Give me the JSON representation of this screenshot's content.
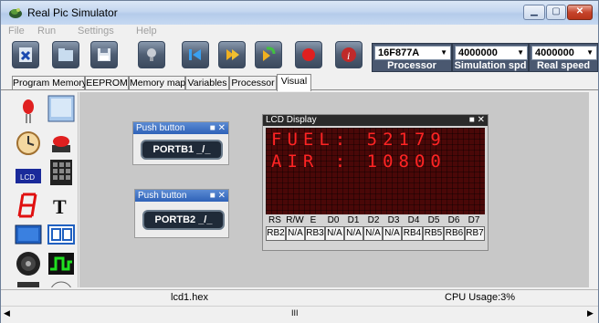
{
  "window": {
    "title": "Real Pic Simulator"
  },
  "menu": [
    {
      "label": "File",
      "mnemonic": "F"
    },
    {
      "label": "Run",
      "mnemonic": "R"
    },
    {
      "label": "Settings",
      "mnemonic": "S"
    },
    {
      "label": "Help",
      "mnemonic": "H"
    }
  ],
  "toolbar": {
    "icons": [
      "close-file-icon",
      "open-folder-icon",
      "save-icon",
      "lightbulb-icon",
      "step-back-icon",
      "run-icon",
      "step-into-icon",
      "stop-icon",
      "info-icon"
    ],
    "processor": {
      "value": "16F877A",
      "label": "Processor"
    },
    "sim_speed": {
      "value": "4000000",
      "label": "Simulation spd"
    },
    "real_speed": {
      "value": "4000000",
      "label": "Real speed"
    }
  },
  "tabs": [
    "Program Memory",
    "EEPROM",
    "Memory map",
    "Variables",
    "Processor",
    "Visual"
  ],
  "active_tab": "Visual",
  "palette": [
    "led-icon",
    "lcd-panel-icon",
    "clock-icon",
    "push-button-icon",
    "lcd-text-icon",
    "keypad-icon",
    "seven-segment-icon",
    "text-tool-icon",
    "monitor-icon",
    "dual-box-icon",
    "speaker-icon",
    "oscilloscope-icon"
  ],
  "push_buttons": [
    {
      "title": "Push button",
      "label": "PORTB1 _/_"
    },
    {
      "title": "Push button",
      "label": "PORTB2 _/_"
    }
  ],
  "lcd": {
    "title": "LCD Display",
    "lines": [
      "FUEL: 52179",
      "AIR : 10800"
    ],
    "pin_labels": [
      "RS",
      "R/W",
      "E",
      "D0",
      "D1",
      "D2",
      "D3",
      "D4",
      "D5",
      "D6",
      "D7"
    ],
    "pin_values": [
      "RB2",
      "N/A",
      "RB3",
      "N/A",
      "N/A",
      "N/A",
      "N/A",
      "RB4",
      "RB5",
      "RB6",
      "RB7"
    ]
  },
  "status": {
    "file": "lcd1.hex",
    "cpu": "CPU Usage:3%"
  },
  "scrollbar": {
    "mid": "III"
  }
}
